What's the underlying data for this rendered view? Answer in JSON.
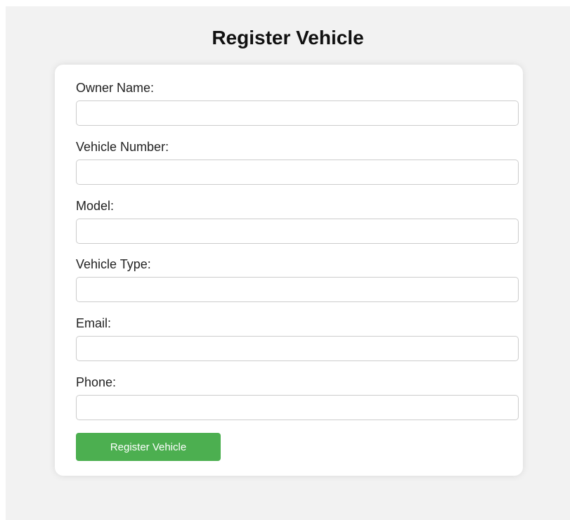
{
  "page": {
    "title": "Register Vehicle"
  },
  "form": {
    "fields": [
      {
        "label": "Owner Name:",
        "value": "",
        "placeholder": ""
      },
      {
        "label": "Vehicle Number:",
        "value": "",
        "placeholder": ""
      },
      {
        "label": "Model:",
        "value": "",
        "placeholder": ""
      },
      {
        "label": "Vehicle Type:",
        "value": "",
        "placeholder": ""
      },
      {
        "label": "Email:",
        "value": "",
        "placeholder": ""
      },
      {
        "label": "Phone:",
        "value": "",
        "placeholder": ""
      }
    ],
    "submit_label": "Register Vehicle"
  },
  "colors": {
    "background": "#f2f2f2",
    "card": "#ffffff",
    "button": "#4caf50",
    "button_text": "#ffffff"
  }
}
